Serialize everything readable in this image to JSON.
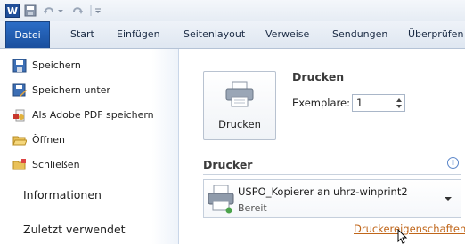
{
  "quick_access": {
    "app_icon_letter": "W",
    "icons": [
      "word-app-icon",
      "save-icon",
      "undo-icon",
      "redo-icon",
      "customize-qat-icon"
    ]
  },
  "ribbon": {
    "tabs": [
      "Datei",
      "Start",
      "Einfügen",
      "Seitenlayout",
      "Verweise",
      "Sendungen",
      "Überprüfen"
    ],
    "active_tab": "Datei"
  },
  "backstage_nav": {
    "items": [
      {
        "label": "Speichern",
        "icon": "save-icon"
      },
      {
        "label": "Speichern unter",
        "icon": "save-as-icon"
      },
      {
        "label": "Als Adobe PDF speichern",
        "icon": "pdf-icon"
      },
      {
        "label": "Öffnen",
        "icon": "open-folder-icon"
      },
      {
        "label": "Schließen",
        "icon": "close-folder-icon"
      }
    ],
    "sections": [
      "Informationen",
      "Zuletzt verwendet"
    ]
  },
  "print": {
    "button_label": "Drucken",
    "heading": "Drucken",
    "copies_label": "Exemplare:",
    "copies_value": "1"
  },
  "printer": {
    "heading": "Drucker",
    "name": "USPO_Kopierer an uhrz-winprint2",
    "status": "Bereit",
    "properties_link": "Druckereigenschaften"
  },
  "colors": {
    "accent": "#1f5ab0",
    "link": "#c0661a"
  }
}
